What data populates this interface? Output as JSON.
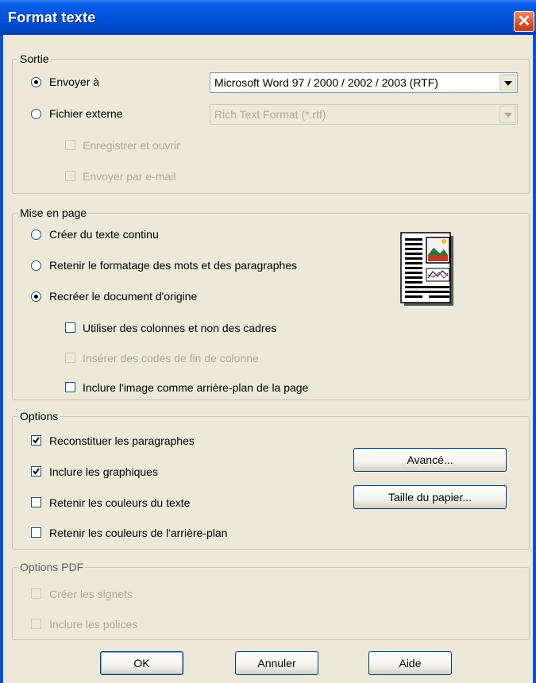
{
  "window": {
    "title": "Format texte",
    "close_icon": "close-icon"
  },
  "output": {
    "legend": "Sortie",
    "send_to": {
      "label": "Envoyer à",
      "checked": true,
      "combo_value": "Microsoft Word 97 / 2000 / 2002 / 2003 (RTF)"
    },
    "external_file": {
      "label": "Fichier externe",
      "checked": false,
      "combo_value": "Rich Text Format (*.rtf)"
    },
    "save_open": {
      "label": "Enregistrer et ouvrir",
      "checked": false,
      "enabled": false
    },
    "send_email": {
      "label": "Envoyer par e-mail",
      "checked": false,
      "enabled": false
    }
  },
  "layout": {
    "legend": "Mise en page",
    "continuous": {
      "label": "Créer du texte continu",
      "checked": false
    },
    "retain_format": {
      "label": "Retenir le formatage des mots et des paragraphes",
      "checked": false
    },
    "recreate": {
      "label": "Recréer le document d'origine",
      "checked": true
    },
    "use_columns": {
      "label": "Utiliser des colonnes et non des cadres",
      "checked": false,
      "enabled": true
    },
    "column_break": {
      "label": "Insérer des codes de fin de colonne",
      "checked": false,
      "enabled": false
    },
    "include_image": {
      "label": "Inclure l'image comme arrière-plan de la page",
      "checked": false,
      "enabled": true
    },
    "preview_icon": "document-layout-icon"
  },
  "options": {
    "legend": "Options",
    "rebuild_paragraphs": {
      "label": "Reconstituer les paragraphes",
      "checked": true
    },
    "include_graphics": {
      "label": "Inclure les graphiques",
      "checked": true
    },
    "text_colors": {
      "label": "Retenir les couleurs du texte",
      "checked": false
    },
    "bg_colors": {
      "label": "Retenir les couleurs de l'arrière-plan",
      "checked": false
    },
    "advanced_button": "Avancé...",
    "paper_size_button": "Taille du papier..."
  },
  "pdf_options": {
    "legend": "Options PDF",
    "bookmarks": {
      "label": "Créer les signets",
      "checked": false,
      "enabled": false
    },
    "fonts": {
      "label": "Inclure les polices",
      "checked": false,
      "enabled": false
    }
  },
  "buttons": {
    "ok": "OK",
    "cancel": "Annuler",
    "help": "Aide"
  },
  "colors": {
    "titlebar": "#0053dd",
    "dialog_bg": "#ece9d8",
    "close": "#d8502a",
    "disabled_text": "#aca899"
  }
}
